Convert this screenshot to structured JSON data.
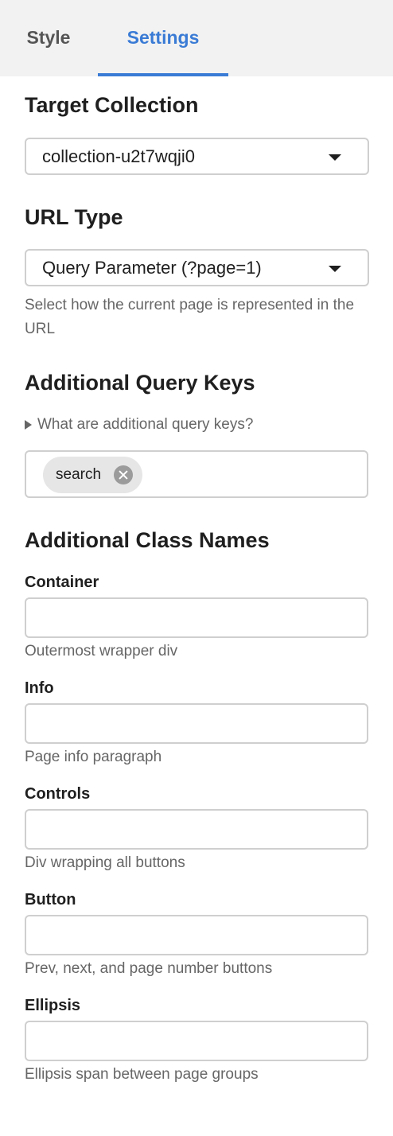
{
  "tabs": {
    "style": "Style",
    "settings": "Settings",
    "active": "Settings",
    "accent_color": "#3a7bd5"
  },
  "target_collection": {
    "heading": "Target Collection",
    "selected": "collection-u2t7wqji0"
  },
  "url_type": {
    "heading": "URL Type",
    "selected": "Query Parameter (?page=1)",
    "help": "Select how the current page is represented in the URL"
  },
  "query_keys": {
    "heading": "Additional Query Keys",
    "disclosure": "What are additional query keys?",
    "tags": [
      {
        "label": "search"
      }
    ]
  },
  "class_names": {
    "heading": "Additional Class Names",
    "fields": [
      {
        "label": "Container",
        "value": "",
        "hint": "Outermost wrapper div"
      },
      {
        "label": "Info",
        "value": "",
        "hint": "Page info paragraph"
      },
      {
        "label": "Controls",
        "value": "",
        "hint": "Div wrapping all buttons"
      },
      {
        "label": "Button",
        "value": "",
        "hint": "Prev, next, and page number buttons"
      },
      {
        "label": "Ellipsis",
        "value": "",
        "hint": "Ellipsis span between page groups"
      }
    ]
  },
  "icons": {
    "select_caret": "caret-down-icon",
    "disclosure": "triangle-right-icon",
    "tag_remove": "close-circle-icon"
  }
}
